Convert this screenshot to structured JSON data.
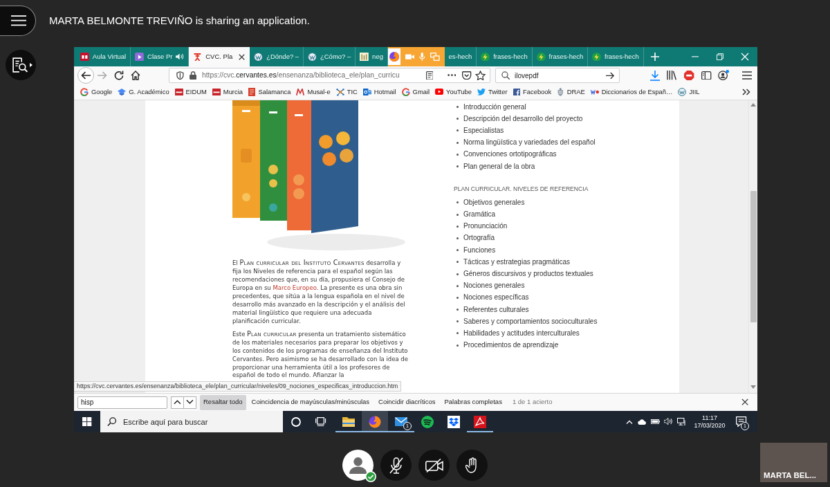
{
  "meeting": {
    "title": "MARTA BELMONTE TREVIÑO is sharing an application."
  },
  "browser": {
    "tabs": [
      {
        "label": "Aula Virtual",
        "selected": false,
        "audio": false
      },
      {
        "label": "Clase Pr",
        "selected": false,
        "audio": true
      },
      {
        "label": "CVC. Pla",
        "selected": true,
        "audio": false
      },
      {
        "label": "¿Dónde? –",
        "selected": false,
        "audio": false
      },
      {
        "label": "¿Cómo? –",
        "selected": false,
        "audio": false
      },
      {
        "label": "neg",
        "selected": false,
        "audio": false
      },
      {
        "label": "es-hech",
        "selected": false,
        "audio": false
      },
      {
        "label": "frases-hech",
        "selected": false,
        "audio": false
      },
      {
        "label": "frases-hech",
        "selected": false,
        "audio": false
      },
      {
        "label": "frases-hech",
        "selected": false,
        "audio": false
      }
    ],
    "forward_disabled": true,
    "address": {
      "prefix": "https://cvc.",
      "domain": "cervantes.es",
      "path": "/ensenanza/biblioteca_ele/plan_curricu"
    },
    "search": {
      "value": "ilovepdf"
    },
    "bookmarks": [
      "Google",
      "G. Académico",
      "EIDUM",
      "Murcia",
      "Salamanca",
      "Musal-e",
      "TIC",
      "Hotmail",
      "Gmail",
      "YouTube",
      "Twitter",
      "Facebook",
      "DRAE",
      "Diccionarios de Españ…",
      "JIIL"
    ],
    "page": {
      "paragraphs": [
        {
          "runs": [
            {
              "kind": "text",
              "text": "El "
            },
            {
              "kind": "smallcaps",
              "text": "Plan curricular del Instituto Cervantes"
            },
            {
              "kind": "text",
              "text": " desarrolla y fija los Niveles de referencia para el español según las recomendaciones que, en su día, propusiera el Consejo de Europa en su "
            },
            {
              "kind": "link",
              "text": "Marco Europeo"
            },
            {
              "kind": "text",
              "text": ". La presente es una obra sin precedentes, que sitúa a la lengua española en el nivel de desarrollo más avanzado en la descripción y el análisis del material lingüístico que requiere una adecuada planificación curricular."
            }
          ]
        },
        {
          "runs": [
            {
              "kind": "text",
              "text": "Este "
            },
            {
              "kind": "smallcaps",
              "text": "Plan curricular"
            },
            {
              "kind": "text",
              "text": " presenta un tratamiento sistemático de los materiales necesarios para preparar los objetivos y los contenidos de los programas de enseñanza del Instituto Cervantes. Pero asimismo se ha desarrollado con la idea de proporcionar una herramienta útil a los profesores de español de todo el mundo. Afianzar la"
            }
          ]
        }
      ],
      "toc": [
        {
          "items": [
            "Introducción general",
            "Descripción del desarrollo del proyecto",
            "Especialistas",
            "Norma lingüística y variedades del español",
            "Convenciones ortotipográficas",
            "Plan general de la obra"
          ]
        },
        {
          "heading": "PLAN CURRICULAR. NIVELES DE REFERENCIA",
          "items": [
            "Objetivos generales",
            "Gramática",
            "Pronunciación",
            "Ortografía",
            "Funciones",
            "Tácticas y estrategias pragmáticas",
            "Géneros discursivos y productos textuales",
            "Nociones generales",
            "Nociones específicas",
            "Referentes culturales",
            "Saberes y comportamientos socioculturales",
            "Habilidades y actitudes interculturales",
            "Procedimientos de aprendizaje"
          ]
        }
      ]
    },
    "status_url": "https://cvc.cervantes.es/ensenanza/biblioteca_ele/plan_curricular/niveles/09_nociones_especificas_introduccion.htm",
    "find_bar": {
      "value": "hisp",
      "options": [
        {
          "label": "Resaltar todo",
          "pressed": true
        },
        {
          "label": "Coincidencia de mayúsculas/minúsculas",
          "pressed": false
        },
        {
          "label": "Coincidir diacríticos",
          "pressed": false
        },
        {
          "label": "Palabras completas",
          "pressed": false
        }
      ],
      "result": "1 de 1 acierto"
    }
  },
  "taskbar": {
    "search": {
      "placeholder": "Escribe aquí para buscar"
    },
    "apps": [
      {
        "running": true,
        "active": false
      },
      {
        "running": true,
        "active": true
      },
      {
        "running": true,
        "active": false,
        "badge": "1"
      },
      {
        "running": false,
        "active": false
      },
      {
        "running": false,
        "active": false
      },
      {
        "running": true,
        "active": false
      }
    ],
    "clock": {
      "time": "11:17",
      "date": "17/03/2020"
    },
    "notifications": {
      "badge": "1"
    }
  },
  "controls": {
    "microphone_on": false,
    "camera_on": false
  },
  "video_tile": {
    "name": "MARTA BEL..."
  }
}
